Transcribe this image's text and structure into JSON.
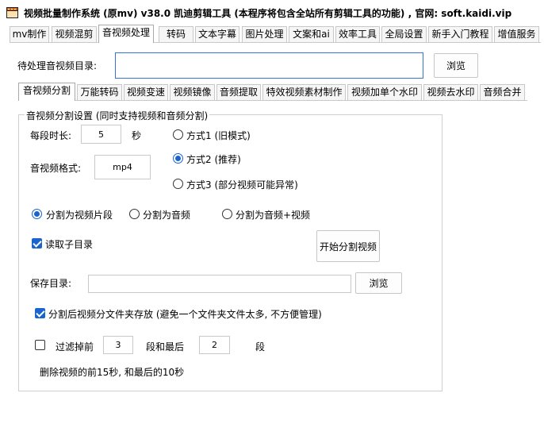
{
  "window": {
    "title": "视频批量制作系统 (原mv) v38.0    凯迪剪辑工具 (本程序将包含全站所有剪辑工具的功能) , 官网: soft.kaidi.vip"
  },
  "top_tabs": [
    "mv制作",
    "视频混剪",
    "音视频处理",
    "转码",
    "文本字幕",
    "图片处理",
    "文案和ai",
    "效率工具",
    "全局设置",
    "新手入门教程",
    "增值服务"
  ],
  "input_dir": {
    "label": "待处理音视频目录:",
    "value": "",
    "browse": "浏览"
  },
  "sub_tabs": [
    "音视频分割",
    "万能转码",
    "视频变速",
    "视频镜像",
    "音频提取",
    "特效视频素材制作",
    "视频加单个水印",
    "视频去水印",
    "音频合并"
  ],
  "split": {
    "group_title": "音视频分割设置 (同时支持视频和音频分割)",
    "duration_label": "每段时长:",
    "duration_value": "5",
    "duration_unit": "秒",
    "format_label": "音视频格式:",
    "format_value": "mp4",
    "mode_options": [
      "方式1 (旧模式)",
      "方式2 (推荐)",
      "方式3 (部分视频可能异常)"
    ],
    "mode_selected": 1,
    "output_options": [
      "分割为视频片段",
      "分割为音频",
      "分割为音频+视频"
    ],
    "output_selected": 0,
    "read_subdir": "读取子目录",
    "read_subdir_checked": true,
    "start_button": "开始分割视频",
    "save_dir_label": "保存目录:",
    "save_dir_value": "",
    "save_browse": "浏览",
    "subfolder_option": "分割后视频分文件夹存放 (避免一个文件夹文件太多, 不方便管理)",
    "subfolder_checked": true,
    "filter_checked": false,
    "filter_label": "过滤掉前",
    "filter_front_value": "3",
    "filter_mid": "段和最后",
    "filter_back_value": "2",
    "filter_unit": "段",
    "filter_note": "删除视频的前15秒, 和最后的10秒"
  }
}
